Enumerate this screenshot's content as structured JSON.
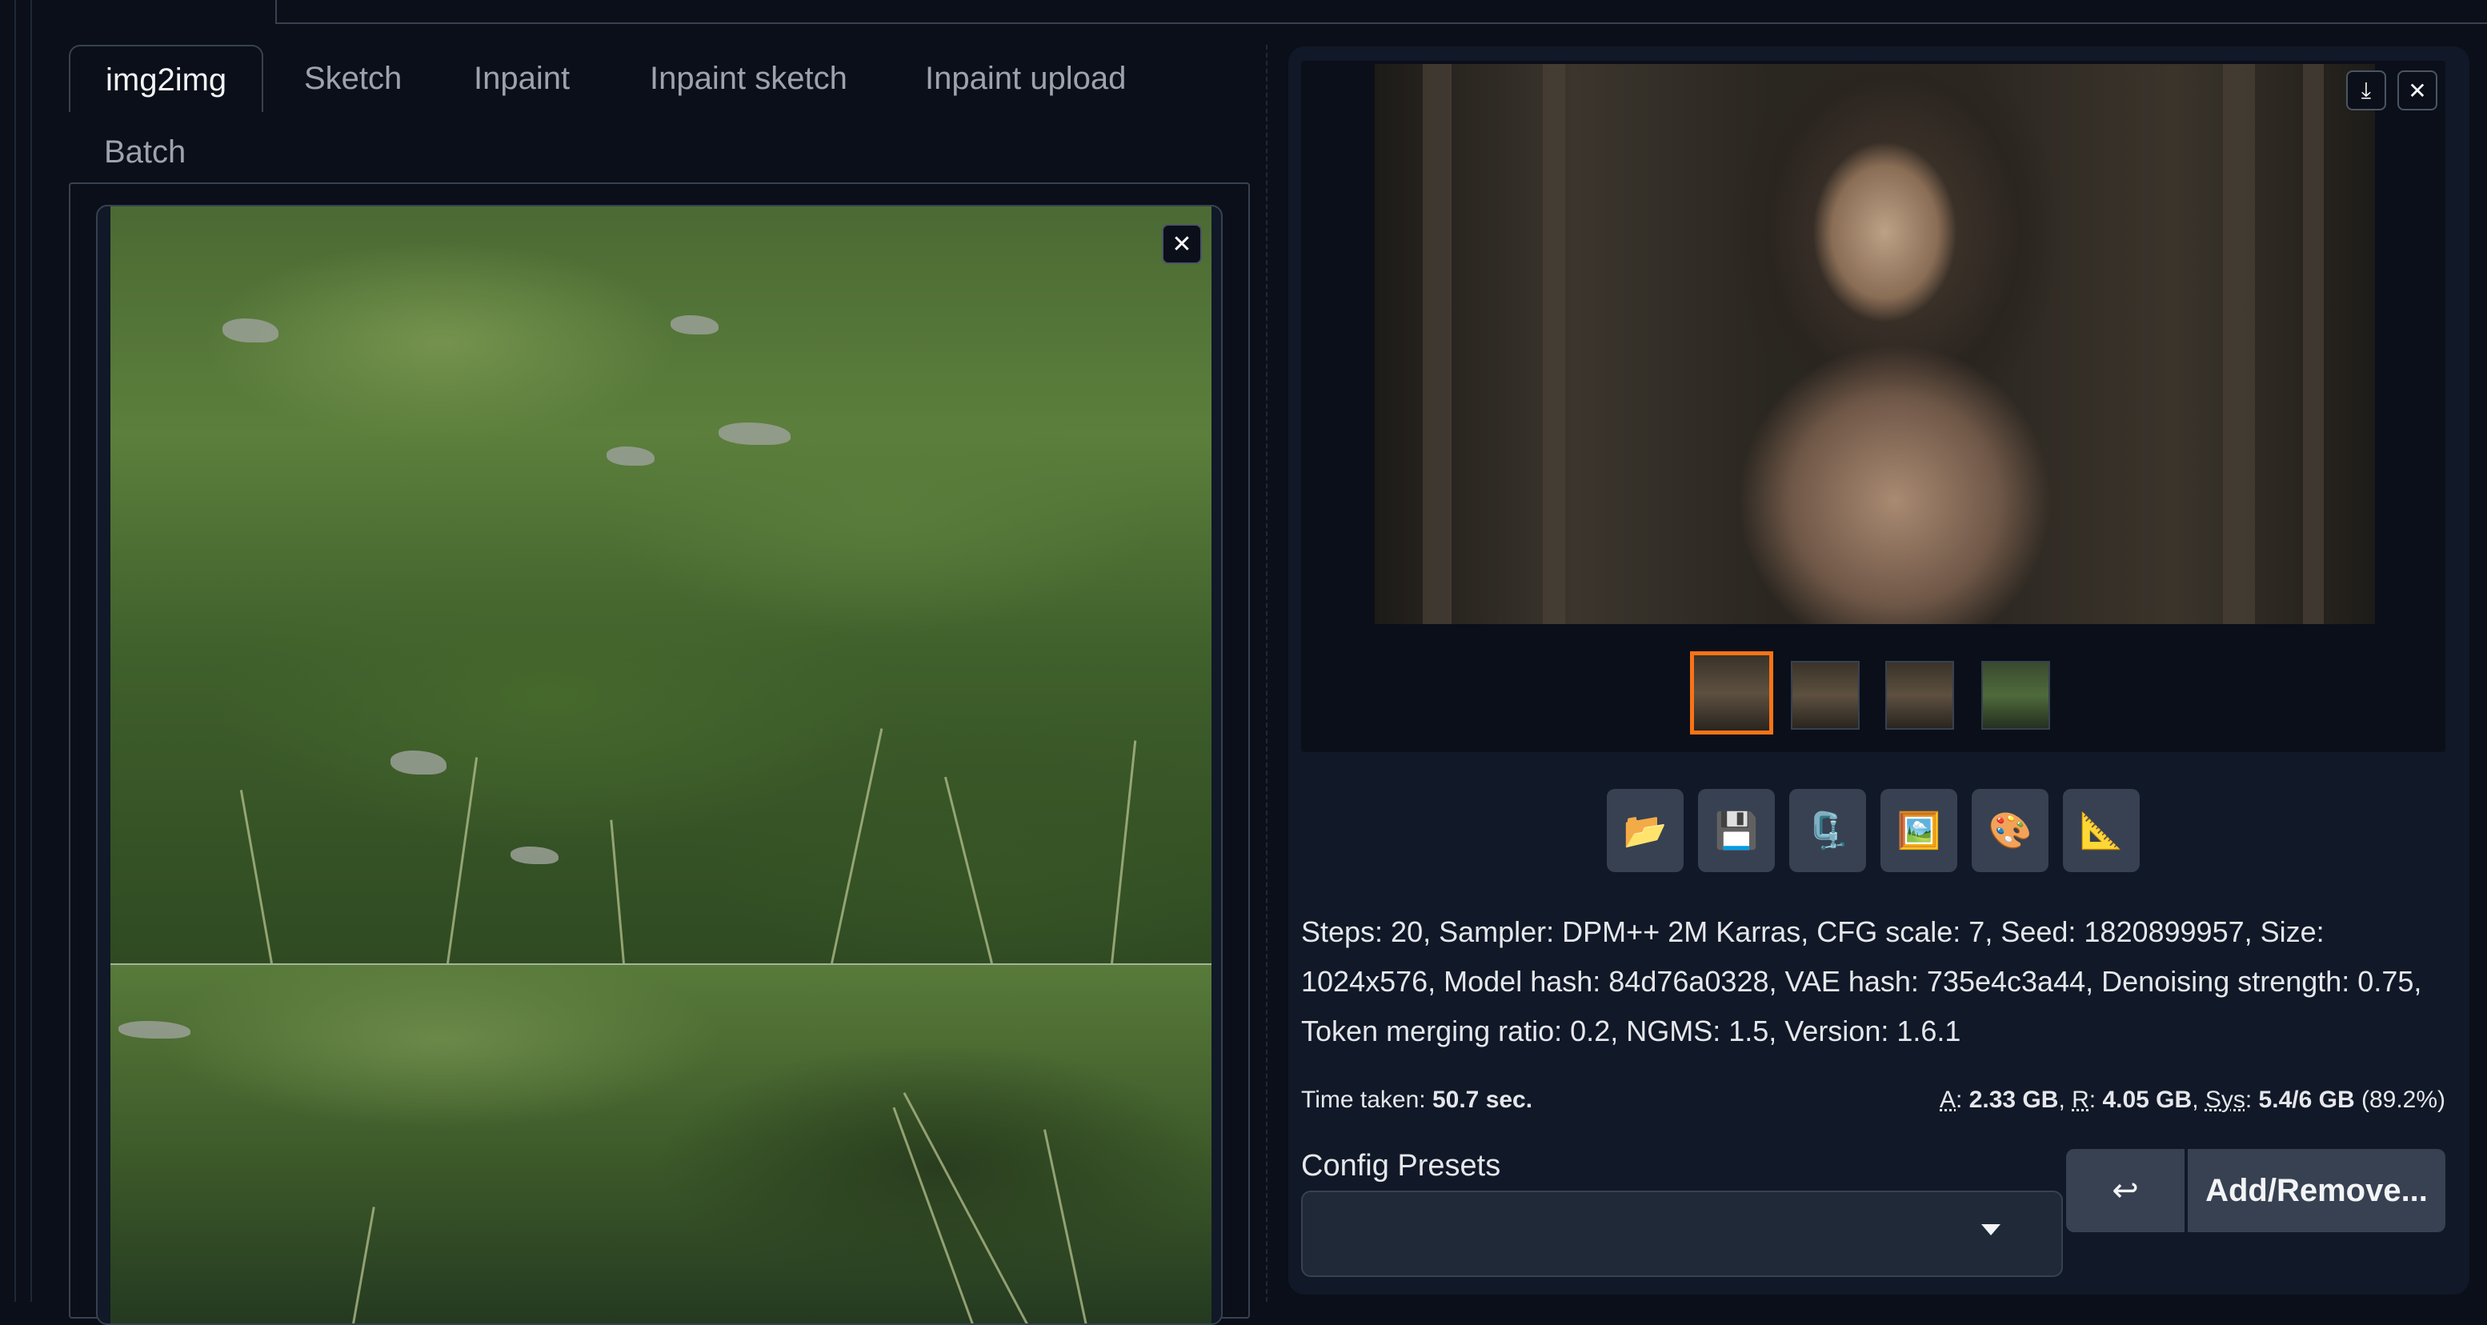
{
  "tabs": {
    "row1": [
      "img2img",
      "Sketch",
      "Inpaint",
      "Inpaint sketch",
      "Inpaint upload"
    ],
    "row2": "Batch",
    "active": "img2img"
  },
  "icons": {
    "clear": "close-icon",
    "download": "download-icon",
    "close": "close-icon",
    "tools": [
      "folder-icon",
      "save-icon",
      "zip-save-icon",
      "image-icon",
      "palette-icon",
      "ruler-icon"
    ]
  },
  "tool_glyphs": [
    "📂",
    "💾",
    "🗜️",
    "🖼️",
    "🎨",
    "📐"
  ],
  "generation_info": "Steps: 20, Sampler: DPM++ 2M Karras, CFG scale: 7, Seed: 1820899957, Size: 1024x576, Model hash: 84d76a0328, VAE hash: 735e4c3a44, Denoising strength: 0.75, Token merging ratio: 0.2, NGMS: 1.5, Version: 1.6.1",
  "time_taken": {
    "label": "Time taken:",
    "value": "50.7 sec."
  },
  "memory": {
    "a_label": "A",
    "a_value": "2.33 GB",
    "r_label": "R",
    "r_value": "4.05 GB",
    "sys_label": "Sys",
    "sys_value": "5.4/6 GB",
    "sys_pct": "(89.2%)"
  },
  "config": {
    "label": "Config Presets",
    "selected": "",
    "undo_label": "↩",
    "add_label": "Add/Remove..."
  },
  "glyphs": {
    "close": "✕",
    "download": "⤓"
  }
}
